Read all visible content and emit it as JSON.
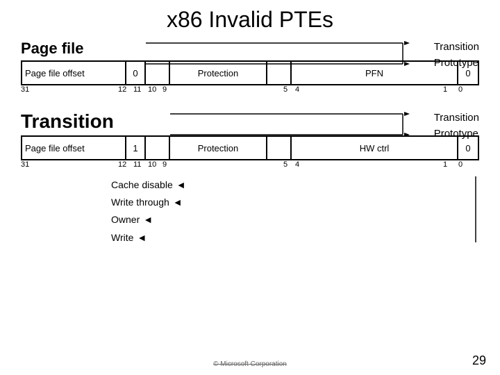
{
  "title": "x86 Invalid PTEs",
  "upper": {
    "page_file_label": "Page file",
    "transition_label": "Transition",
    "prototype_label": "Prototype",
    "pte": {
      "cell1": "Page file offset",
      "cell2": "0",
      "cell3": "",
      "cell4": "Protection",
      "cell5": "",
      "cell6": "PFN",
      "cell7": "0"
    },
    "bits": {
      "b31": "31",
      "b12": "12",
      "b11": "11",
      "b10": "10",
      "b9": "9",
      "b5": "5",
      "b4": "4",
      "b1": "1",
      "b0": "0"
    }
  },
  "lower": {
    "transition_label": "Transition",
    "transition_label2": "Transition",
    "prototype_label": "Prototype",
    "pte": {
      "cell1": "Page file offset",
      "cell2": "1",
      "cell3": "",
      "cell4": "Protection",
      "cell5": "",
      "cell6": "HW ctrl",
      "cell7": "0"
    },
    "bits": {
      "b31": "31",
      "b12": "12",
      "b11": "11",
      "b10": "10",
      "b9": "9",
      "b5": "5",
      "b4": "4",
      "b1": "1",
      "b0": "0"
    },
    "annotations": [
      "Cache disable",
      "Write through",
      "Owner",
      "Write"
    ]
  },
  "page_number": "29",
  "copyright": "© Microsoft Corporation"
}
